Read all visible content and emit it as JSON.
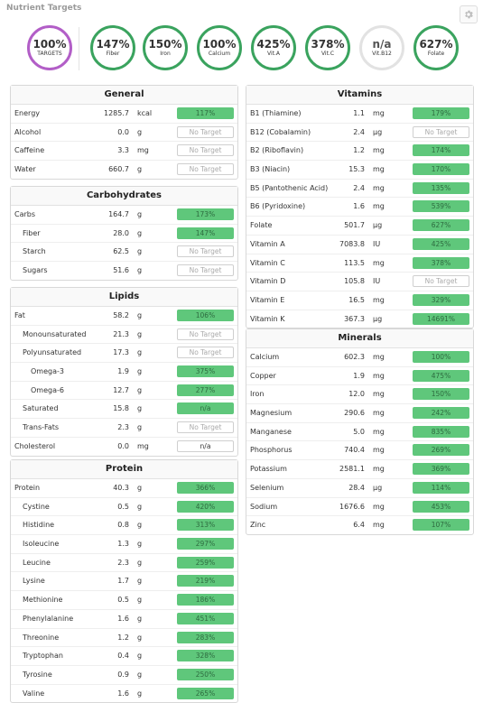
{
  "header": {
    "title": "Nutrient Targets",
    "settings_icon": "gear-icon"
  },
  "summary": [
    {
      "pct": "100%",
      "label": "TARGETS",
      "style": "main"
    },
    {
      "pct": "147%",
      "label": "Fiber",
      "style": "ok"
    },
    {
      "pct": "150%",
      "label": "Iron",
      "style": "ok"
    },
    {
      "pct": "100%",
      "label": "Calcium",
      "style": "ok"
    },
    {
      "pct": "425%",
      "label": "Vit.A",
      "style": "ok"
    },
    {
      "pct": "378%",
      "label": "Vit.C",
      "style": "ok"
    },
    {
      "pct": "n/a",
      "label": "Vit.B12",
      "style": "na"
    },
    {
      "pct": "627%",
      "label": "Folate",
      "style": "ok"
    }
  ],
  "colors": {
    "accent_green": "#5fc77b",
    "ring_green": "#3aa35e",
    "ring_purple": "#b25ec7"
  },
  "panels": [
    {
      "id": "general",
      "title": "General",
      "rows": [
        {
          "name": "Energy",
          "amount": "1285.7",
          "unit": "kcal",
          "target": "117%",
          "status": "green"
        },
        {
          "name": "Alcohol",
          "amount": "0.0",
          "unit": "g",
          "target": "No Target",
          "status": "none"
        },
        {
          "name": "Caffeine",
          "amount": "3.3",
          "unit": "mg",
          "target": "No Target",
          "status": "none"
        },
        {
          "name": "Water",
          "amount": "660.7",
          "unit": "g",
          "target": "No Target",
          "status": "none"
        }
      ]
    },
    {
      "id": "carbohydrates",
      "title": "Carbohydrates",
      "rows": [
        {
          "name": "Carbs",
          "amount": "164.7",
          "unit": "g",
          "target": "173%",
          "status": "green"
        },
        {
          "name": "Fiber",
          "amount": "28.0",
          "unit": "g",
          "target": "147%",
          "status": "green",
          "indent": 1
        },
        {
          "name": "Starch",
          "amount": "62.5",
          "unit": "g",
          "target": "No Target",
          "status": "none",
          "indent": 1
        },
        {
          "name": "Sugars",
          "amount": "51.6",
          "unit": "g",
          "target": "No Target",
          "status": "none",
          "indent": 1
        }
      ]
    },
    {
      "id": "lipids",
      "title": "Lipids",
      "rows": [
        {
          "name": "Fat",
          "amount": "58.2",
          "unit": "g",
          "target": "106%",
          "status": "green"
        },
        {
          "name": "Monounsaturated",
          "amount": "21.3",
          "unit": "g",
          "target": "No Target",
          "status": "none",
          "indent": 1
        },
        {
          "name": "Polyunsaturated",
          "amount": "17.3",
          "unit": "g",
          "target": "No Target",
          "status": "none",
          "indent": 1
        },
        {
          "name": "Omega-3",
          "amount": "1.9",
          "unit": "g",
          "target": "375%",
          "status": "green",
          "indent": 2
        },
        {
          "name": "Omega-6",
          "amount": "12.7",
          "unit": "g",
          "target": "277%",
          "status": "green",
          "indent": 2
        },
        {
          "name": "Saturated",
          "amount": "15.8",
          "unit": "g",
          "target": "n/a",
          "status": "green",
          "indent": 1
        },
        {
          "name": "Trans-Fats",
          "amount": "2.3",
          "unit": "g",
          "target": "No Target",
          "status": "none",
          "indent": 1
        },
        {
          "name": "Cholesterol",
          "amount": "0.0",
          "unit": "mg",
          "target": "n/a",
          "status": "blank"
        }
      ]
    },
    {
      "id": "protein",
      "title": "Protein",
      "rows": [
        {
          "name": "Protein",
          "amount": "40.3",
          "unit": "g",
          "target": "366%",
          "status": "green"
        },
        {
          "name": "Cystine",
          "amount": "0.5",
          "unit": "g",
          "target": "420%",
          "status": "green",
          "indent": 1
        },
        {
          "name": "Histidine",
          "amount": "0.8",
          "unit": "g",
          "target": "313%",
          "status": "green",
          "indent": 1
        },
        {
          "name": "Isoleucine",
          "amount": "1.3",
          "unit": "g",
          "target": "297%",
          "status": "green",
          "indent": 1
        },
        {
          "name": "Leucine",
          "amount": "2.3",
          "unit": "g",
          "target": "259%",
          "status": "green",
          "indent": 1
        },
        {
          "name": "Lysine",
          "amount": "1.7",
          "unit": "g",
          "target": "219%",
          "status": "green",
          "indent": 1
        },
        {
          "name": "Methionine",
          "amount": "0.5",
          "unit": "g",
          "target": "186%",
          "status": "green",
          "indent": 1
        },
        {
          "name": "Phenylalanine",
          "amount": "1.6",
          "unit": "g",
          "target": "451%",
          "status": "green",
          "indent": 1
        },
        {
          "name": "Threonine",
          "amount": "1.2",
          "unit": "g",
          "target": "283%",
          "status": "green",
          "indent": 1
        },
        {
          "name": "Tryptophan",
          "amount": "0.4",
          "unit": "g",
          "target": "328%",
          "status": "green",
          "indent": 1
        },
        {
          "name": "Tyrosine",
          "amount": "0.9",
          "unit": "g",
          "target": "250%",
          "status": "green",
          "indent": 1
        },
        {
          "name": "Valine",
          "amount": "1.6",
          "unit": "g",
          "target": "265%",
          "status": "green",
          "indent": 1
        }
      ]
    },
    {
      "id": "vitamins",
      "title": "Vitamins",
      "rows": [
        {
          "name": "B1 (Thiamine)",
          "amount": "1.1",
          "unit": "mg",
          "target": "179%",
          "status": "green"
        },
        {
          "name": "B12 (Cobalamin)",
          "amount": "2.4",
          "unit": "µg",
          "target": "No Target",
          "status": "none"
        },
        {
          "name": "B2 (Riboflavin)",
          "amount": "1.2",
          "unit": "mg",
          "target": "174%",
          "status": "green"
        },
        {
          "name": "B3 (Niacin)",
          "amount": "15.3",
          "unit": "mg",
          "target": "170%",
          "status": "green"
        },
        {
          "name": "B5 (Pantothenic Acid)",
          "amount": "2.4",
          "unit": "mg",
          "target": "135%",
          "status": "green"
        },
        {
          "name": "B6 (Pyridoxine)",
          "amount": "1.6",
          "unit": "mg",
          "target": "539%",
          "status": "green"
        },
        {
          "name": "Folate",
          "amount": "501.7",
          "unit": "µg",
          "target": "627%",
          "status": "green"
        },
        {
          "name": "Vitamin A",
          "amount": "7083.8",
          "unit": "IU",
          "target": "425%",
          "status": "green"
        },
        {
          "name": "Vitamin C",
          "amount": "113.5",
          "unit": "mg",
          "target": "378%",
          "status": "green"
        },
        {
          "name": "Vitamin D",
          "amount": "105.8",
          "unit": "IU",
          "target": "No Target",
          "status": "none"
        },
        {
          "name": "Vitamin E",
          "amount": "16.5",
          "unit": "mg",
          "target": "329%",
          "status": "green"
        },
        {
          "name": "Vitamin K",
          "amount": "367.3",
          "unit": "µg",
          "target": "14691%",
          "status": "green"
        }
      ]
    },
    {
      "id": "minerals",
      "title": "Minerals",
      "rows": [
        {
          "name": "Calcium",
          "amount": "602.3",
          "unit": "mg",
          "target": "100%",
          "status": "green"
        },
        {
          "name": "Copper",
          "amount": "1.9",
          "unit": "mg",
          "target": "475%",
          "status": "green"
        },
        {
          "name": "Iron",
          "amount": "12.0",
          "unit": "mg",
          "target": "150%",
          "status": "green"
        },
        {
          "name": "Magnesium",
          "amount": "290.6",
          "unit": "mg",
          "target": "242%",
          "status": "green"
        },
        {
          "name": "Manganese",
          "amount": "5.0",
          "unit": "mg",
          "target": "835%",
          "status": "green"
        },
        {
          "name": "Phosphorus",
          "amount": "740.4",
          "unit": "mg",
          "target": "269%",
          "status": "green"
        },
        {
          "name": "Potassium",
          "amount": "2581.1",
          "unit": "mg",
          "target": "369%",
          "status": "green"
        },
        {
          "name": "Selenium",
          "amount": "28.4",
          "unit": "µg",
          "target": "114%",
          "status": "green"
        },
        {
          "name": "Sodium",
          "amount": "1676.6",
          "unit": "mg",
          "target": "453%",
          "status": "green"
        },
        {
          "name": "Zinc",
          "amount": "6.4",
          "unit": "mg",
          "target": "107%",
          "status": "green"
        }
      ]
    }
  ]
}
